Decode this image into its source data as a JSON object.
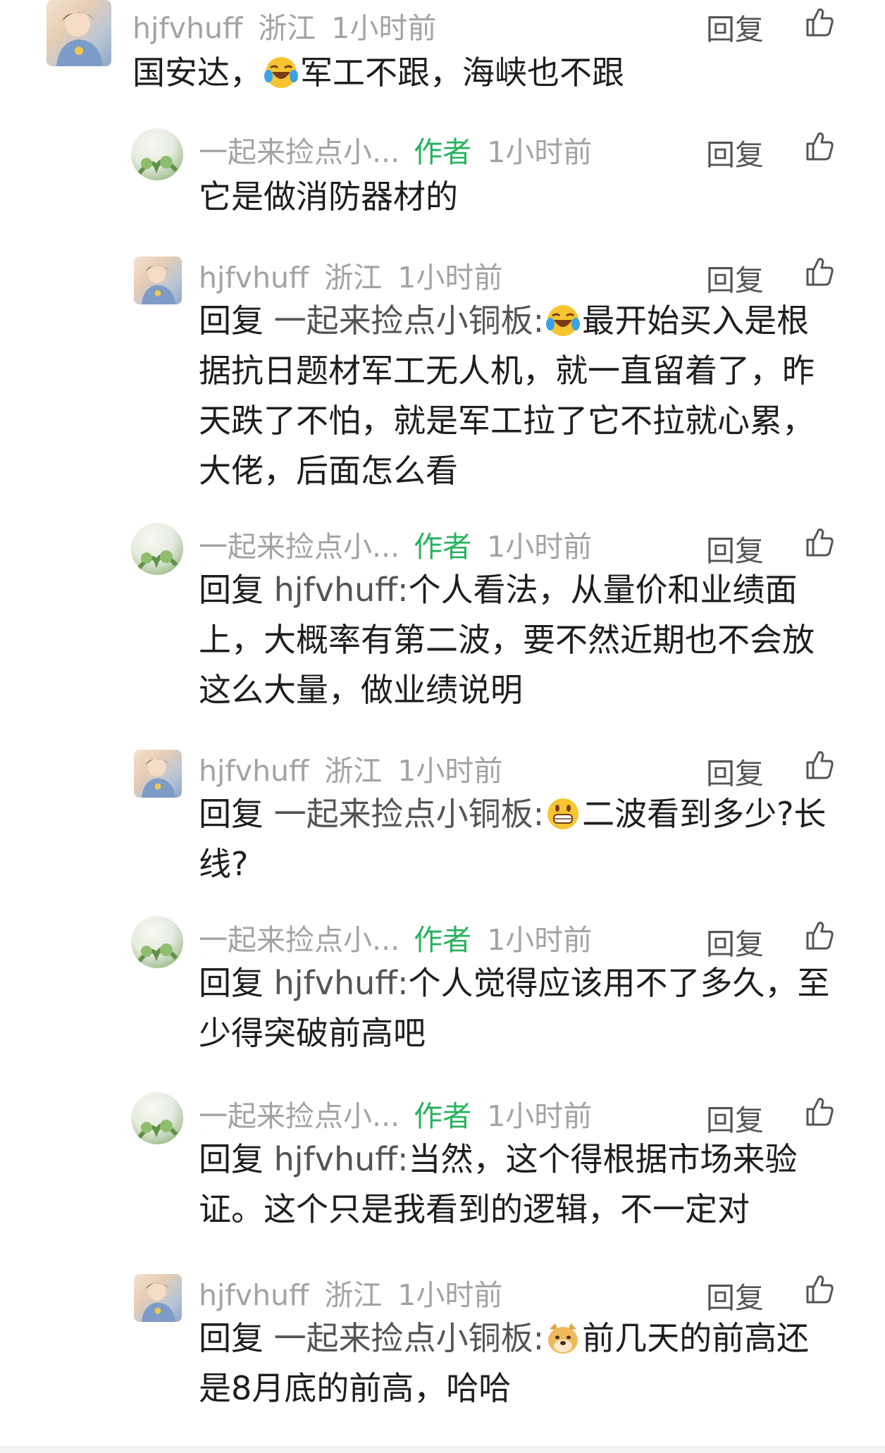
{
  "comments": [
    {
      "name": "hjfvhuff",
      "badge": "",
      "location": "浙江",
      "time": "1小时前",
      "reply_label": "回复",
      "reply_prefix": "",
      "reply_target": "",
      "emoji": "laugh-cry",
      "text_before": "国安达，",
      "text_after": "军工不跟，海峡也不跟"
    },
    {
      "name": "一起来捡点小...",
      "badge": "作者",
      "location": "",
      "time": "1小时前",
      "reply_label": "回复",
      "reply_prefix": "",
      "reply_target": "",
      "emoji": "",
      "text_before": "",
      "text_after": "它是做消防器材的"
    },
    {
      "name": "hjfvhuff",
      "badge": "",
      "location": "浙江",
      "time": "1小时前",
      "reply_label": "回复",
      "reply_prefix": "回复 ",
      "reply_target": "一起来捡点小铜板:",
      "emoji": "laugh-cry",
      "text_before": "",
      "text_after": "最开始买入是根据抗日题材军工无人机，就一直留着了，昨天跌了不怕，就是军工拉了它不拉就心累，大佬，后面怎么看"
    },
    {
      "name": "一起来捡点小...",
      "badge": "作者",
      "location": "",
      "time": "1小时前",
      "reply_label": "回复",
      "reply_prefix": "回复 ",
      "reply_target": "hjfvhuff:",
      "emoji": "",
      "text_before": "",
      "text_after": "个人看法，从量价和业绩面上，大概率有第二波，要不然近期也不会放这么大量，做业绩说明"
    },
    {
      "name": "hjfvhuff",
      "badge": "",
      "location": "浙江",
      "time": "1小时前",
      "reply_label": "回复",
      "reply_prefix": "回复 ",
      "reply_target": "一起来捡点小铜板:",
      "emoji": "grin",
      "text_before": "",
      "text_after": "二波看到多少?长线?"
    },
    {
      "name": "一起来捡点小...",
      "badge": "作者",
      "location": "",
      "time": "1小时前",
      "reply_label": "回复",
      "reply_prefix": "回复 ",
      "reply_target": "hjfvhuff:",
      "emoji": "",
      "text_before": "",
      "text_after": "个人觉得应该用不了多久，至少得突破前高吧"
    },
    {
      "name": "一起来捡点小...",
      "badge": "作者",
      "location": "",
      "time": "1小时前",
      "reply_label": "回复",
      "reply_prefix": "回复 ",
      "reply_target": "hjfvhuff:",
      "emoji": "",
      "text_before": "",
      "text_after": "当然，这个得根据市场来验证。这个只是我看到的逻辑，不一定对"
    },
    {
      "name": "hjfvhuff",
      "badge": "",
      "location": "浙江",
      "time": "1小时前",
      "reply_label": "回复",
      "reply_prefix": "回复 ",
      "reply_target": "一起来捡点小铜板:",
      "emoji": "doge",
      "text_before": "",
      "text_after": "前几天的前高还是8月底的前高，哈哈"
    }
  ],
  "avatar_types": [
    "user",
    "author",
    "user",
    "author",
    "user",
    "author",
    "author",
    "user"
  ],
  "colors": {
    "author_badge": "#27b25f",
    "meta": "#a3a3a3",
    "text": "#1e1e1e",
    "reply_target": "#555555"
  }
}
